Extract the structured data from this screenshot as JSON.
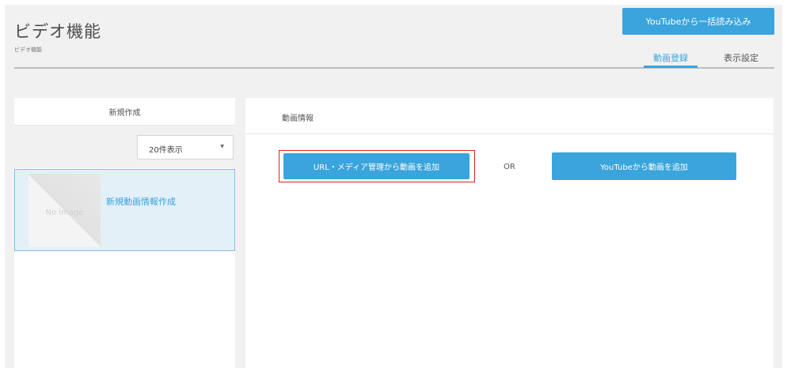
{
  "header": {
    "title": "ビデオ機能",
    "breadcrumb": "ビデオ機能",
    "bulk_import_label": "YouTubeから一括読み込み",
    "tabs": [
      {
        "label": "動画登録",
        "active": true
      },
      {
        "label": "表示設定",
        "active": false
      }
    ]
  },
  "left": {
    "new_button_label": "新規作成",
    "per_page": "20件表示",
    "items": [
      {
        "thumb_text": "No image",
        "title": "新規動画情報作成"
      }
    ]
  },
  "main": {
    "section_title": "動画情報",
    "url_media_button_label": "URL・メディア管理から動画を追加",
    "or_label": "OR",
    "youtube_button_label": "YouTubeから動画を追加"
  },
  "colors": {
    "accent": "#3aa4dc",
    "highlight": "#d9271c",
    "background": "#f1f1f1"
  }
}
